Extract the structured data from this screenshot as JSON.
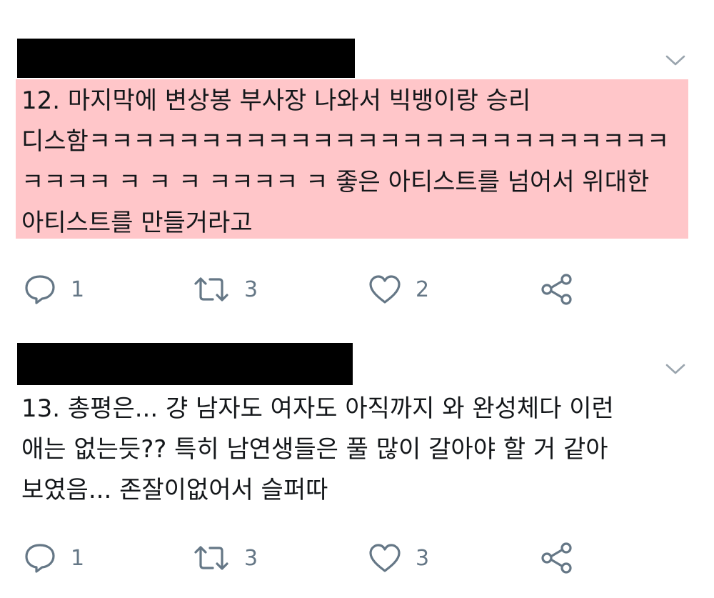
{
  "tweets": [
    {
      "text": "12. 마지막에 변상봉 부사장 나와서 빅뱅이랑 승리 디스함ㅋㅋㅋㅋㅋㅋㅋㅋㅋㅋㅋㅋㅋㅋㅋㅋㅋㅋㅋㅋㅋㅋㅋㅋㅋㅋ ㅋㅋㅋㅋ ㅋ ㅋ ㅋ ㅋㅋㅋㅋ ㅋ 좋은 아티스트를 넘어서 위대한 아티스트를 만들거라고",
      "highlighted": true,
      "replies": "1",
      "retweets": "3",
      "likes": "2"
    },
    {
      "text": "13. 총평은... 걍 남자도 여자도 아직까지 와 완성체다 이런 애는 없는듯?? 특히 남연생들은 풀 많이 갈아야 할 거 같아 보였음... 존잘이없어서 슬퍼따",
      "highlighted": false,
      "replies": "1",
      "retweets": "3",
      "likes": "3"
    }
  ],
  "icons": {
    "reply": "reply-icon",
    "retweet": "retweet-icon",
    "like": "heart-icon",
    "share": "share-icon",
    "menu": "chevron-down-icon"
  },
  "colors": {
    "highlight": "#ffc6c9",
    "icon": "#657786",
    "redaction": "#000000"
  }
}
